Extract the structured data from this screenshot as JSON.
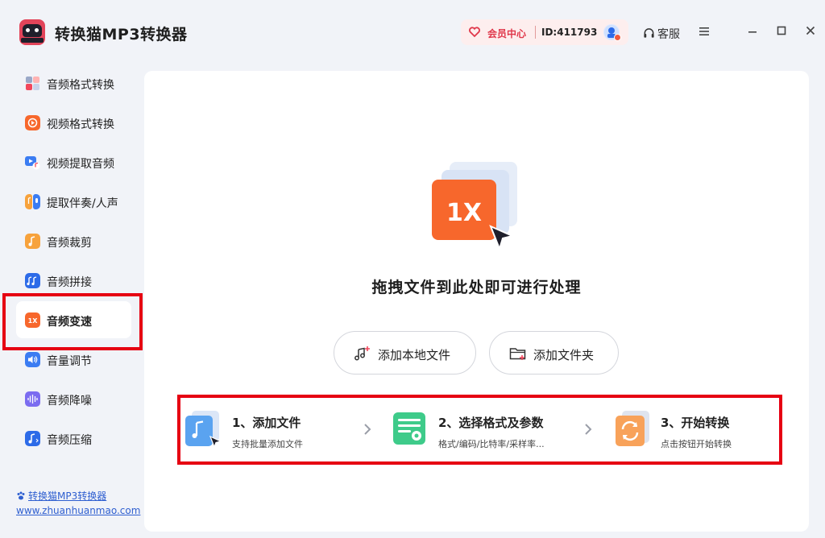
{
  "app": {
    "title": "转换猫MP3转换器",
    "logo_text": "转换猫"
  },
  "header": {
    "vip_label": "会员中心",
    "user_id": "ID:411793",
    "service_label": "客服"
  },
  "sidebar": {
    "items": [
      {
        "label": "音频格式转换",
        "icon": "audio-format-icon"
      },
      {
        "label": "视频格式转换",
        "icon": "video-format-icon"
      },
      {
        "label": "视频提取音频",
        "icon": "extract-audio-icon"
      },
      {
        "label": "提取伴奏/人声",
        "icon": "extract-vocal-icon"
      },
      {
        "label": "音频裁剪",
        "icon": "audio-cut-icon"
      },
      {
        "label": "音频拼接",
        "icon": "audio-join-icon"
      },
      {
        "label": "音频变速",
        "icon": "audio-speed-icon",
        "active": true
      },
      {
        "label": "音量调节",
        "icon": "volume-icon"
      },
      {
        "label": "音频降噪",
        "icon": "denoise-icon"
      },
      {
        "label": "音频压缩",
        "icon": "compress-icon"
      }
    ],
    "footer_brand": "转换猫MP3转换器",
    "footer_url": "www.zhuanhuanmao.com"
  },
  "main": {
    "speed_badge": "1X",
    "drop_title": "拖拽文件到此处即可进行处理",
    "add_file_label": "添加本地文件",
    "add_folder_label": "添加文件夹",
    "steps": [
      {
        "title": "1、添加文件",
        "desc": "支持批量添加文件"
      },
      {
        "title": "2、选择格式及参数",
        "desc": "格式/编码/比特率/采样率..."
      },
      {
        "title": "3、开始转换",
        "desc": "点击按钮开始转换"
      }
    ]
  },
  "colors": {
    "accent": "#f7672c",
    "highlight_red": "#e60012",
    "vip_red": "#e0384b",
    "link_blue": "#2f5fd0"
  }
}
